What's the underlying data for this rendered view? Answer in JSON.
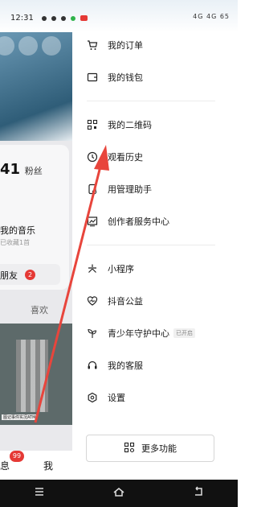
{
  "status_bar": {
    "time": "12:31",
    "right_text": "4G  4G  65"
  },
  "background_profile": {
    "fans": "41",
    "fans_label": "粉丝",
    "music": "我的音乐",
    "collected": "已收藏1首",
    "friends_label": "朋友",
    "friends_badge": "2",
    "likes_tab": "喜欢",
    "caption": "图记事件实况ATM",
    "messages_label": "息",
    "messages_badge": "99",
    "me_label": "我"
  },
  "drawer": {
    "items": [
      {
        "label": "我的订单",
        "icon": "cart-icon"
      },
      {
        "label": "我的钱包",
        "icon": "wallet-icon"
      },
      {
        "label": "我的二维码",
        "icon": "qrcode-icon"
      },
      {
        "label": "观看历史",
        "icon": "clock-icon"
      },
      {
        "label": "用管理助手",
        "icon": "storage-icon"
      },
      {
        "label": "创作者服务中心",
        "icon": "chart-icon"
      },
      {
        "label": "小程序",
        "icon": "asterisk-icon"
      },
      {
        "label": "抖音公益",
        "icon": "heart-icon"
      },
      {
        "label": "青少年守护中心",
        "icon": "sprout-icon",
        "tag": "已开启"
      },
      {
        "label": "我的客服",
        "icon": "headset-icon"
      },
      {
        "label": "设置",
        "icon": "hexagon-gear-icon"
      }
    ],
    "more_button": "更多功能"
  },
  "colors": {
    "accent_red": "#e53935",
    "arrow": "#e8453c"
  }
}
